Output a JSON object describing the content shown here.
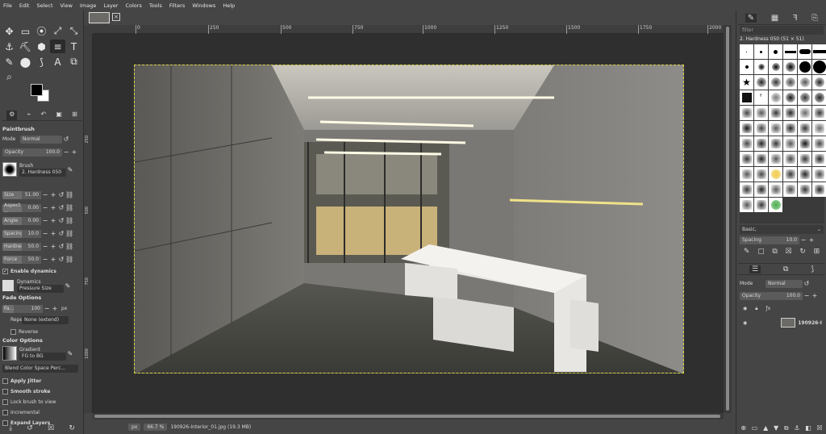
{
  "menu": [
    "File",
    "Edit",
    "Select",
    "View",
    "Image",
    "Layer",
    "Colors",
    "Tools",
    "Filters",
    "Windows",
    "Help"
  ],
  "tool_icons": [
    "✥",
    "▭",
    "⦿",
    "⤢",
    "⤡",
    "⚓",
    "⛏",
    "⬢",
    "≡",
    "T",
    "✎",
    "⬤",
    "⟆",
    "⌕",
    "A",
    "⧉",
    "?"
  ],
  "tool_options": {
    "title": "Paintbrush",
    "mode_label": "Mode",
    "mode_value": "Normal",
    "opacity_label": "Opacity",
    "opacity_value": "100.0",
    "brush_label": "Brush",
    "brush_value": "2. Hardness 050",
    "sliders": [
      {
        "label": "Size",
        "value": "51.00"
      },
      {
        "label": "Aspect ...",
        "value": "0.00"
      },
      {
        "label": "Angle",
        "value": "0.00"
      },
      {
        "label": "Spacing",
        "value": "10.0"
      },
      {
        "label": "Hardness",
        "value": "50.0"
      },
      {
        "label": "Force",
        "value": "50.0"
      }
    ],
    "enable_dynamics": "Enable dynamics",
    "dynamics_label": "Dynamics",
    "dynamics_value": "Pressure Size",
    "fade_title": "Fade Options",
    "fade_length_label": "Fa...",
    "fade_length_value": "100",
    "fade_unit": "px",
    "repeat_label": "Repeat",
    "repeat_value": "None (extend)",
    "reverse": "Reverse",
    "color_title": "Color Options",
    "gradient_label": "Gradient",
    "gradient_value": "FG to BG",
    "blend": "Blend Color Space Perc...",
    "apply_jitter": "Apply Jitter",
    "smooth_stroke": "Smooth stroke",
    "lock_brush": "Lock brush to view",
    "incremental": "Incremental",
    "expand_layers": "Expand Layers"
  },
  "ruler": [
    "0",
    "250",
    "500",
    "750",
    "1000",
    "1250",
    "1500",
    "1750",
    "2000"
  ],
  "vruler": [
    "250",
    "500",
    "750",
    "1000"
  ],
  "status": {
    "unit": "px",
    "zoom": "66.7 %",
    "file": "190926-Interior_01.jpg (19.3 MB)"
  },
  "brushes": {
    "filter_placeholder": "filter",
    "selected": "2. Hardness 050 (51 × 51)",
    "tag": "Basic,",
    "spacing_label": "Spacing",
    "spacing_value": "10.0"
  },
  "layers": {
    "mode_label": "Mode",
    "mode_value": "Normal",
    "opacity_label": "Opacity",
    "opacity_value": "100.0",
    "layer_name": "190926-I"
  }
}
